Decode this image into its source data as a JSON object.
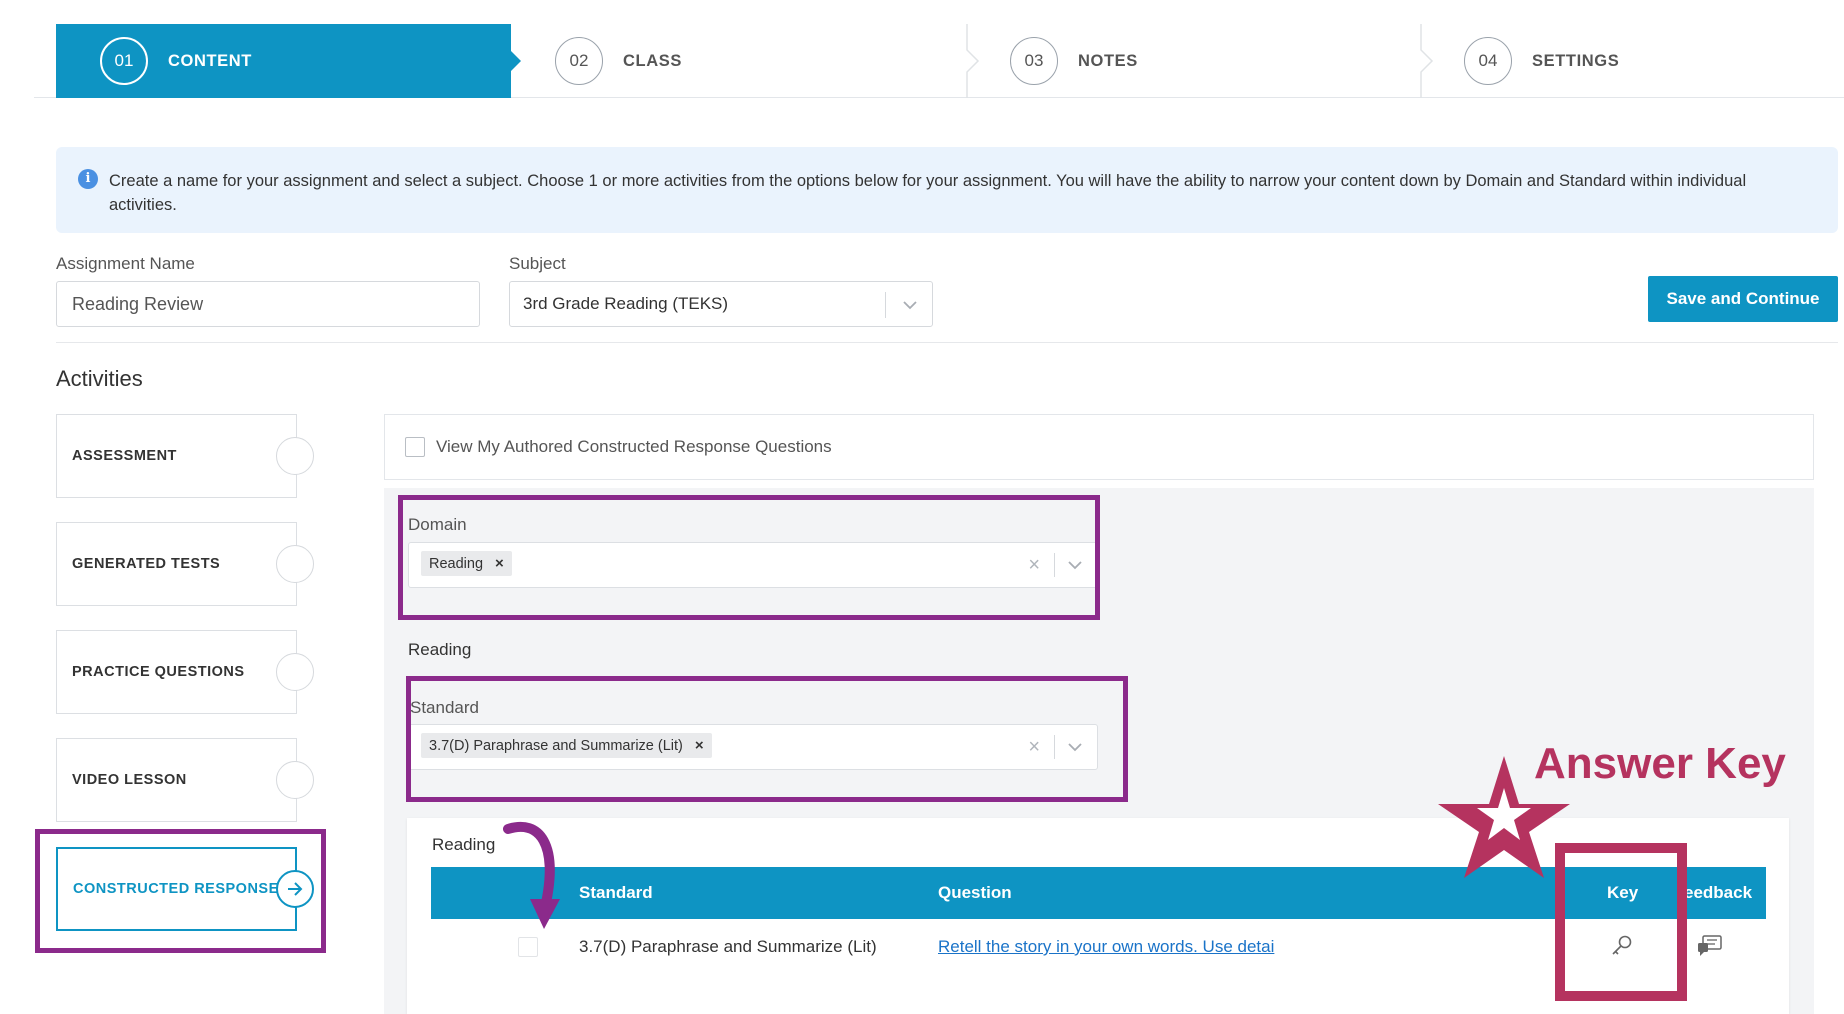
{
  "stepper": {
    "steps": [
      {
        "num": "01",
        "label": "CONTENT"
      },
      {
        "num": "02",
        "label": "CLASS"
      },
      {
        "num": "03",
        "label": "NOTES"
      },
      {
        "num": "04",
        "label": "SETTINGS"
      }
    ],
    "active_index": 0
  },
  "banner": {
    "text": "Create a name for your assignment and select a subject. Choose 1 or more activities from the options below for your assignment. You will have the ability to narrow your content down by Domain and Standard within individual activities."
  },
  "form": {
    "assignment_name_label": "Assignment Name",
    "assignment_name_value": "Reading Review",
    "subject_label": "Subject",
    "subject_value": "3rd Grade Reading (TEKS)",
    "save_label": "Save and Continue"
  },
  "activities": {
    "title": "Activities",
    "items": [
      {
        "label": "ASSESSMENT"
      },
      {
        "label": "GENERATED TESTS"
      },
      {
        "label": "PRACTICE QUESTIONS"
      },
      {
        "label": "VIDEO LESSON"
      },
      {
        "label": "CONSTRUCTED RESPONSE"
      }
    ],
    "active_index": 4
  },
  "panel": {
    "view_authored_label": "View My Authored Constructed Response Questions",
    "domain_label": "Domain",
    "domain_tag": "Reading",
    "section_title": "Reading",
    "standard_label": "Standard",
    "standard_tag": "3.7(D) Paraphrase and Summarize (Lit)"
  },
  "table": {
    "title": "Reading",
    "headers": {
      "standard": "Standard",
      "question": "Question",
      "key": "Key",
      "feedback": "eedback"
    },
    "rows": [
      {
        "standard": "3.7(D) Paraphrase and Summarize (Lit)",
        "question": "Retell the story in your own words. Use detai"
      }
    ]
  },
  "annotation": {
    "answer_key_label": "Answer Key",
    "highlight_color": "#8b2a8b",
    "accent_color": "#b5335f"
  },
  "theme": {
    "primary": "#0e94c3"
  }
}
